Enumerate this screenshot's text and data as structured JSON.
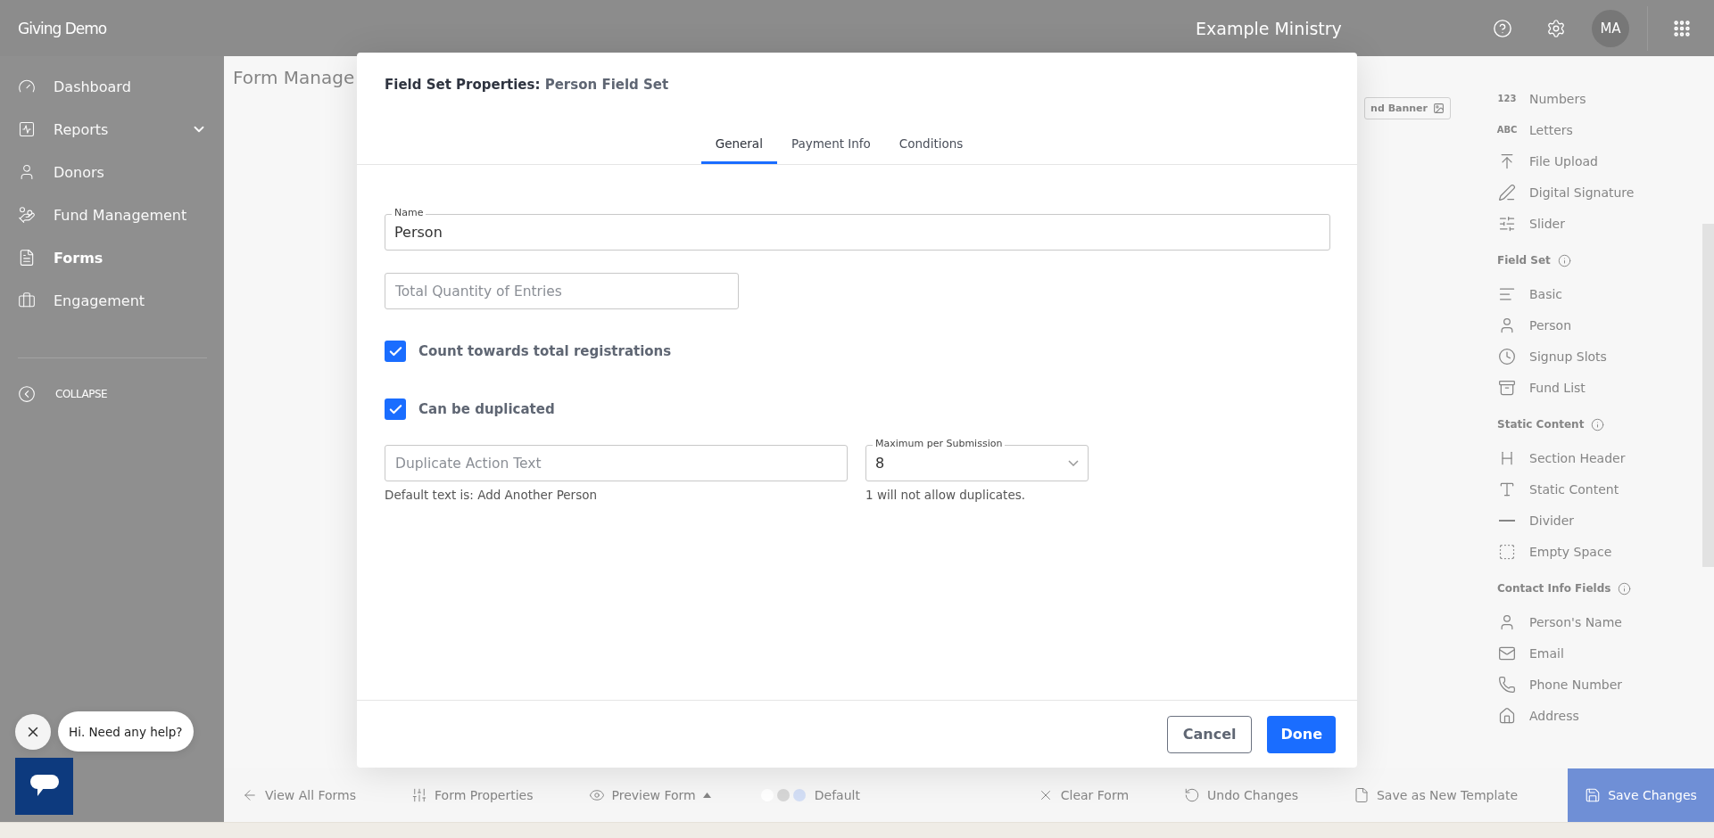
{
  "header": {
    "brand": "Giving Demo",
    "organization": "Example Ministry",
    "avatar": "MA"
  },
  "sidebar": {
    "items": [
      {
        "label": "Dashboard",
        "expandable": false,
        "selected": false
      },
      {
        "label": "Reports",
        "expandable": true,
        "selected": false
      },
      {
        "label": "Donors",
        "expandable": false,
        "selected": false
      },
      {
        "label": "Fund Management",
        "expandable": false,
        "selected": false
      },
      {
        "label": "Forms",
        "expandable": false,
        "selected": true
      },
      {
        "label": "Engagement",
        "expandable": false,
        "selected": false
      }
    ],
    "collapse": "COLLAPSE"
  },
  "page": {
    "title": "Form Manage",
    "banner_button": "nd Banner"
  },
  "palette": {
    "items": [
      {
        "label": "Numbers",
        "glyph": "123"
      },
      {
        "label": "Letters",
        "glyph": "ABC"
      },
      {
        "label": "File Upload"
      },
      {
        "label": "Digital Signature"
      },
      {
        "label": "Slider"
      }
    ],
    "sections": [
      {
        "title": "Field Set",
        "items": [
          {
            "label": "Basic"
          },
          {
            "label": "Person"
          },
          {
            "label": "Signup Slots"
          },
          {
            "label": "Fund List"
          }
        ]
      },
      {
        "title": "Static Content",
        "items": [
          {
            "label": "Section Header"
          },
          {
            "label": "Static Content"
          },
          {
            "label": "Divider"
          },
          {
            "label": "Empty Space"
          }
        ]
      },
      {
        "title": "Contact Info Fields",
        "items": [
          {
            "label": "Person's Name"
          },
          {
            "label": "Email"
          },
          {
            "label": "Phone Number"
          },
          {
            "label": "Address"
          }
        ]
      }
    ]
  },
  "toolbar": {
    "left": [
      "View All Forms",
      "Form Properties",
      "Preview Form"
    ],
    "swatches": [
      {
        "color": "#ffffff"
      },
      {
        "color": "#d6d6d6"
      },
      {
        "color": "#d3def5"
      }
    ],
    "theme": "Default",
    "right": [
      "Clear Form",
      "Undo Changes",
      "Save as New Template"
    ],
    "save": "Save Changes"
  },
  "modal": {
    "title_label": "Field Set Properties:",
    "title_value": "Person Field Set",
    "tabs": [
      {
        "label": "General",
        "selected": true
      },
      {
        "label": "Payment Info",
        "selected": false
      },
      {
        "label": "Conditions",
        "selected": false
      }
    ],
    "name": {
      "label": "Name",
      "value": "Person"
    },
    "quantity": {
      "placeholder": "Total Quantity of Entries"
    },
    "checkboxes": [
      {
        "label": "Count towards total registrations",
        "checked": true
      },
      {
        "label": "Can be duplicated",
        "checked": true
      }
    ],
    "duplicate_text": {
      "placeholder": "Duplicate Action Text",
      "help": "Default text is: Add Another Person"
    },
    "maximum": {
      "label": "Maximum per Submission",
      "value": "8",
      "help": "1 will not allow duplicates."
    },
    "buttons": {
      "cancel": "Cancel",
      "done": "Done"
    }
  },
  "chat": {
    "message": "Hi. Need any help?"
  }
}
